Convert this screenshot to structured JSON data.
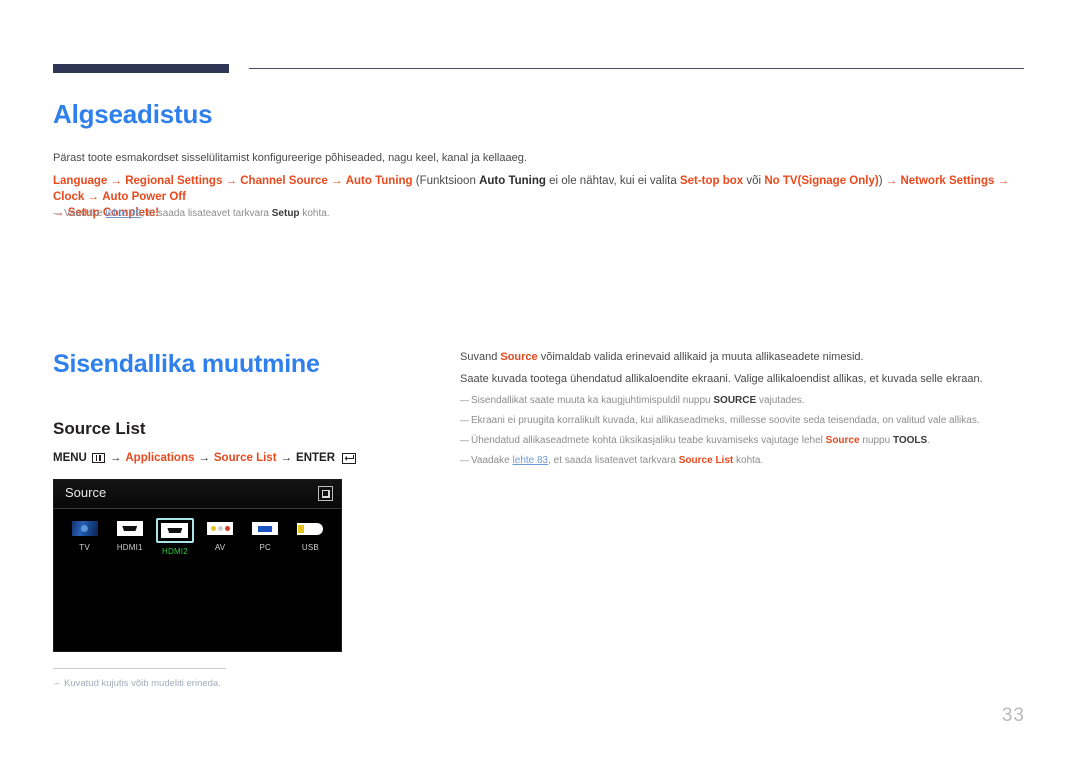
{
  "page": {
    "number": "33"
  },
  "sections": {
    "initial_setup": {
      "title": "Algseadistus",
      "intro": "Pärast toote esmakordset sisselülitamist konfigureerige põhiseaded, nagu keel, kanal ja kellaaeg.",
      "path": {
        "items": [
          "Language",
          "Regional Settings",
          "Channel Source",
          "Auto Tuning"
        ],
        "paren_open": "(Funktsioon",
        "paren_bold_1": "Auto Tuning",
        "paren_mid_1": "ei ole nähtav, kui ei valita",
        "paren_bold_2": "Set-top box",
        "paren_mid_2": "või",
        "paren_bold_3": "No TV(Signage Only)",
        "paren_close": ")",
        "tail_items": [
          "Network Settings",
          "Clock",
          "Auto Power Off",
          "Setup Complete!"
        ],
        "arrow": "→"
      },
      "note": {
        "pre": "Vaadake",
        "link": "lehte 99",
        "mid": ", et saada lisateavet tarkvara",
        "bold": "Setup",
        "post": "kohta."
      }
    },
    "change_input_source": {
      "title": "Sisendallika muutmine",
      "subtitle": "Source List",
      "menu_path": {
        "menu_label": "MENU",
        "menu_icon": "menu-grid-icon",
        "arrow": "→",
        "item1": "Applications",
        "item2": "Source List",
        "enter_label": "ENTER",
        "enter_icon": "enter-return-icon"
      },
      "caption": "Kuvatud kujutis võib mudeliti erineda.",
      "paragraphs": [
        {
          "pre": "Suvand",
          "bold": "Source",
          "post": "võimaldab valida erinevaid allikaid ja muuta allikaseadete nimesid."
        },
        {
          "full": "Saate kuvada tootega ühendatud allikaloendite ekraani. Valige allikaloendist allikas, et kuvada selle ekraan."
        }
      ],
      "notes": [
        {
          "pre": "Sisendallikat saate muuta ka kaugjuhtimispuldil nuppu",
          "bold": "SOURCE",
          "post": "vajutades."
        },
        {
          "full": "Ekraani ei pruugita korralikult kuvada, kui allikaseadmeks, millesse soovite seda teisendada, on valitud vale allikas."
        },
        {
          "pre": "Ühendatud allikaseadmete kohta üksikasjaliku teabe kuvamiseks vajutage lehel",
          "orange_bold": "Source",
          "mid": "nuppu",
          "bold": "TOOLS",
          "post": "."
        },
        {
          "pre": "Vaadake",
          "link": "lehte 83",
          "mid": ", et saada lisateavet tarkvara",
          "orange_bold": "Source List",
          "post": "kohta."
        }
      ]
    }
  },
  "source_panel": {
    "title": "Source",
    "corner_button_icon": "picture-in-picture-icon",
    "items": [
      {
        "label": "TV",
        "icon": "tv-screen-icon",
        "selected": false
      },
      {
        "label": "HDMI1",
        "icon": "hdmi-port-icon",
        "selected": false
      },
      {
        "label": "HDMI2",
        "icon": "hdmi-port-icon",
        "selected": true
      },
      {
        "label": "AV",
        "icon": "av-rca-icon",
        "selected": false
      },
      {
        "label": "PC",
        "icon": "vga-port-icon",
        "selected": false
      },
      {
        "label": "USB",
        "icon": "usb-plug-icon",
        "selected": false
      }
    ],
    "colors": {
      "selected_border": "#a9e4e8",
      "selected_label": "#2ecc40",
      "background": "#000000"
    }
  },
  "theme": {
    "heading_blue": "#2f80ed",
    "accent_orange": "#e8491d",
    "rule_navy": "#2e3655",
    "link_blue": "#6f9ad1"
  }
}
